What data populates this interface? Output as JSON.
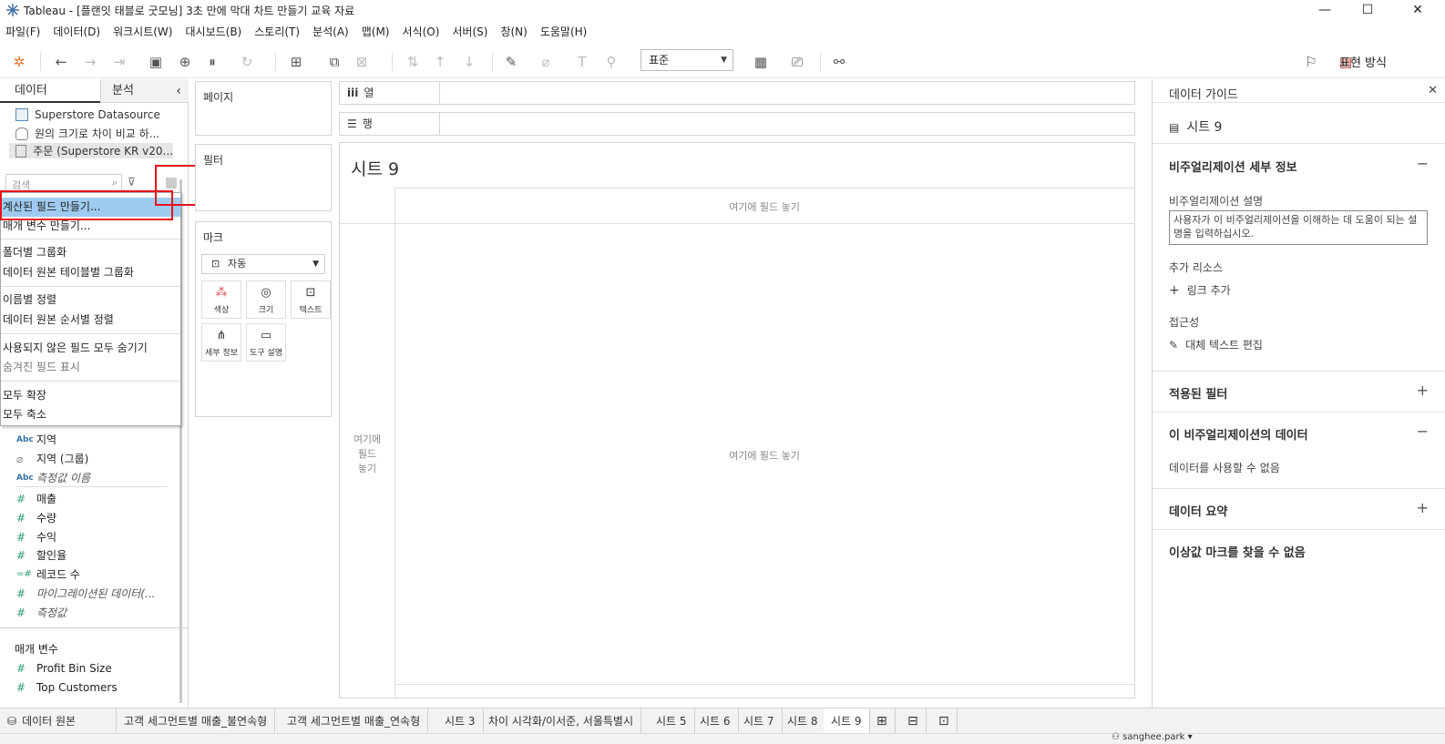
{
  "window": {
    "title": "Tableau - [플랜잇 태블로 굿모닝] 3초 만에 막대 차트 만들기 교육 자료",
    "minimize": "—",
    "maximize": "☐",
    "close": "✕"
  },
  "menu": [
    "파일(F)",
    "데이터(D)",
    "워크시트(W)",
    "대시보드(B)",
    "스토리(T)",
    "분석(A)",
    "맵(M)",
    "서식(O)",
    "서버(S)",
    "창(N)",
    "도움말(H)"
  ],
  "toolbar": {
    "view_size": "표준",
    "show_me": "표현 방식"
  },
  "data_pane": {
    "tab_data": "데이터",
    "tab_analysis": "분석",
    "collapse": "‹",
    "datasources": [
      "Superstore Datasource",
      "원의 크기로 차이 비교 하...",
      "주문 (Superstore KR v20..."
    ],
    "search_placeholder": "검색",
    "fields": [
      {
        "type": "Abc",
        "name": "지역"
      },
      {
        "type": "link",
        "name": "지역 (그룹)"
      },
      {
        "type": "Abc",
        "name": "측정값 이름"
      },
      {
        "type": "#",
        "name": "매출"
      },
      {
        "type": "#",
        "name": "수량"
      },
      {
        "type": "#",
        "name": "수익"
      },
      {
        "type": "#",
        "name": "할인율"
      },
      {
        "type": "=#",
        "name": "레코드 수"
      },
      {
        "type": "#",
        "name": "마이그레이션된 데이터(..."
      },
      {
        "type": "#",
        "name": "측정값"
      }
    ],
    "params_title": "매개 변수",
    "params": [
      "Profit Bin Size",
      "Top Customers"
    ]
  },
  "context_menu": {
    "items": [
      {
        "label": "계산된 필드 만들기...",
        "highlighted": true
      },
      {
        "label": "매개 변수 만들기..."
      },
      {
        "label": "폴더별 그룹화"
      },
      {
        "label": "데이터 원본 테이블별 그룹화"
      },
      {
        "label": "이름별 정렬"
      },
      {
        "label": "데이터 원본 순서별 정렬"
      },
      {
        "label": "사용되지 않은 필드 모두 숨기기"
      },
      {
        "label": "숨겨진 필드 표시",
        "disabled": true
      },
      {
        "label": "모두 확장"
      },
      {
        "label": "모두 축소"
      }
    ]
  },
  "cards": {
    "pages": "페이지",
    "filters": "필터",
    "marks": "마크",
    "mark_type": "자동",
    "mark_buttons": [
      "색상",
      "크기",
      "텍스트",
      "세부 정보",
      "도구 설명"
    ]
  },
  "shelves": {
    "columns": "열",
    "rows": "행"
  },
  "view": {
    "sheet_title": "시트 9",
    "drop_top": "여기에 필드 놓기",
    "drop_left": "여기에\n필드\n놓기",
    "drop_center": "여기에 필드 놓기"
  },
  "guide": {
    "title": "데이터 가이드",
    "close": "✕",
    "sheet": "시트 9",
    "viz_details": "비주얼리제이션 세부 정보",
    "viz_desc_label": "비주얼리제이션 설명",
    "viz_desc_placeholder": "사용자가 이 비주얼리제이션을 이해하는 데 도움이 되는 설명을 입력하십시오.",
    "add_resources": "추가 리소스",
    "add_link": "링크 추가",
    "accessibility": "접근성",
    "edit_alt": "대체 텍스트 편집",
    "applied_filters": "적용된 필터",
    "viz_data": "이 비주얼리제이션의 데이터",
    "no_data": "데이터를 사용할 수 없음",
    "data_summary": "데이터 요약",
    "no_outliers": "이상값 마크를 찾을 수 없음"
  },
  "bottom_tabs": [
    "데이터 원본",
    "고객 세그먼트별 매출_불연속형",
    "고객 세그먼트별 매출_연속형",
    "시트 3",
    "차이 시각화/이서준, 서울특별시",
    "시트 5",
    "시트 6",
    "시트 7",
    "시트 8",
    "시트 9"
  ],
  "active_tab": "시트 9",
  "status": {
    "user": "sanghee.park"
  },
  "colors": {
    "highlight": "#9fcbf0",
    "annotation": "#e8141c",
    "numeric": "#2e9d7c",
    "dimension": "#3872a8"
  }
}
